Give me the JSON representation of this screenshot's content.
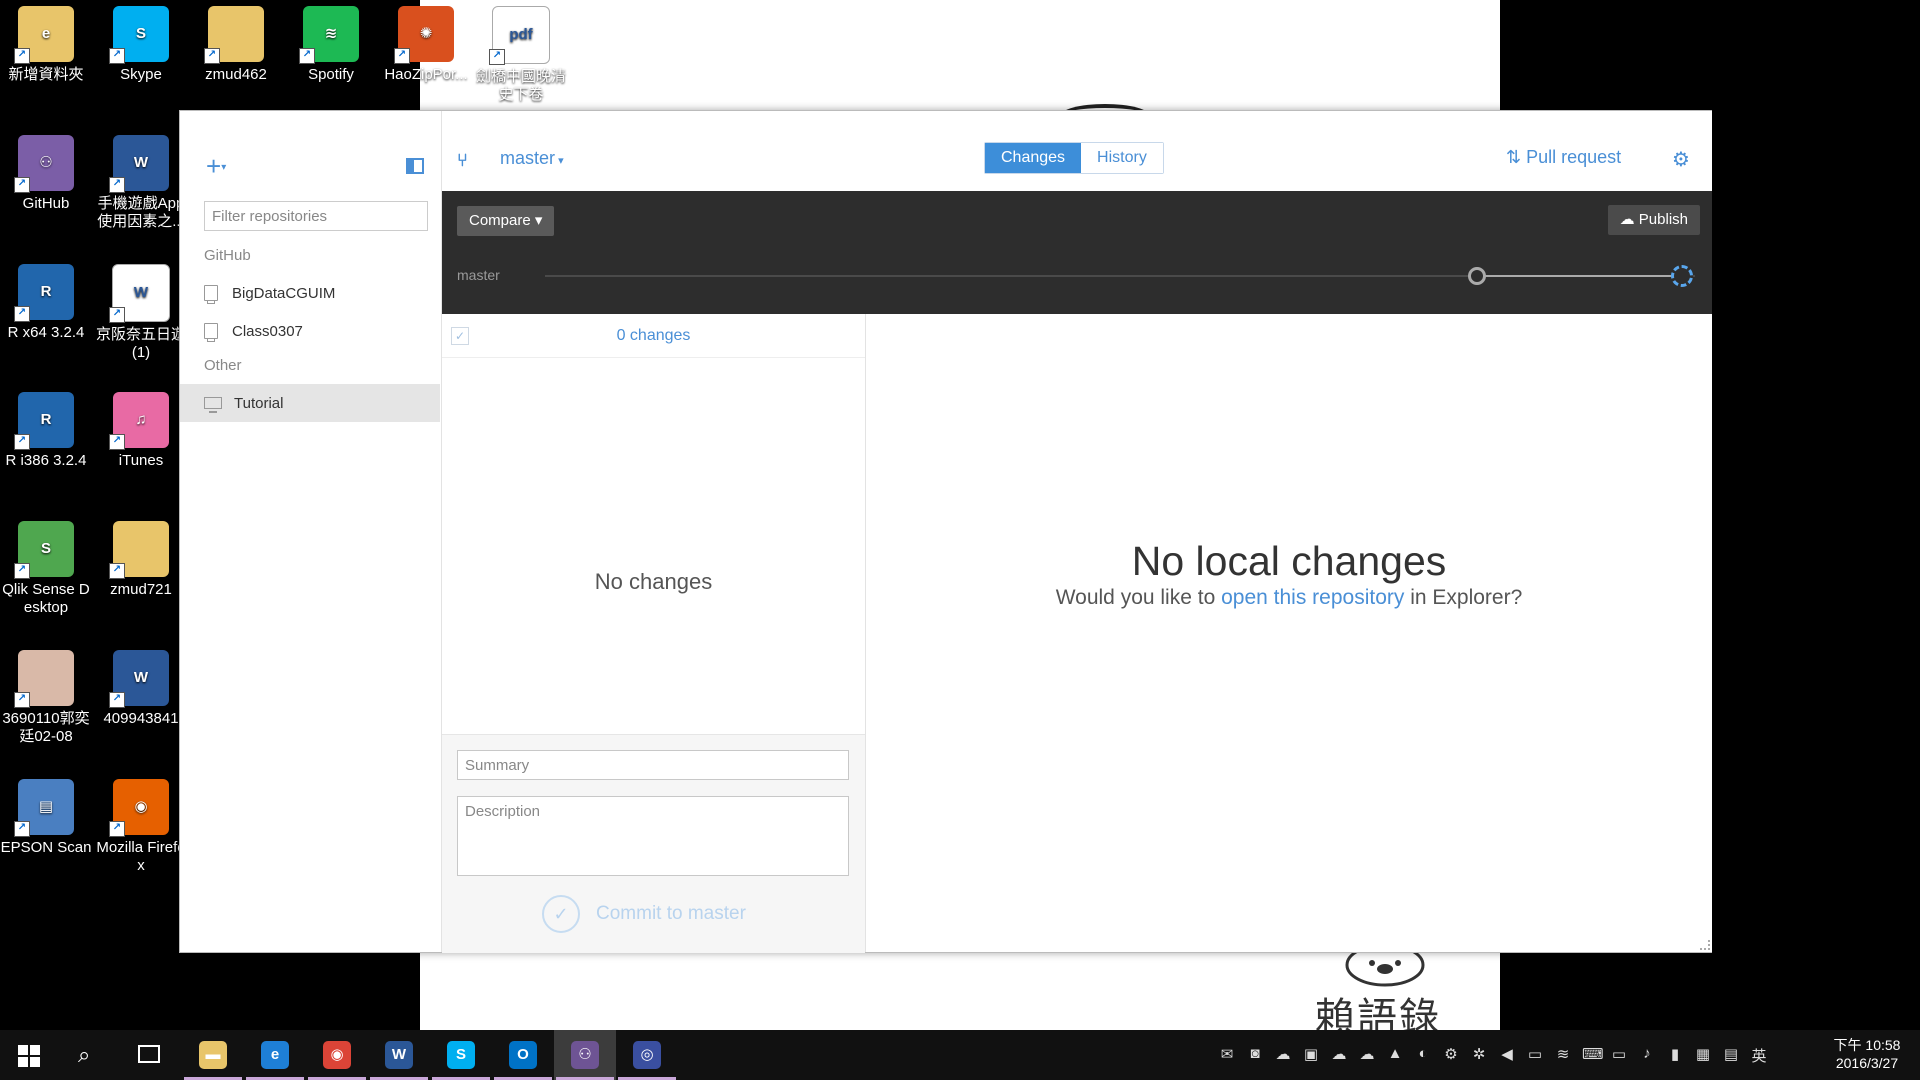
{
  "desktop": {
    "icons": [
      {
        "label": "新增資料夾",
        "color": "#e8c56a",
        "glyph": "e"
      },
      {
        "label": "Skype",
        "color": "#00aff0",
        "glyph": "S"
      },
      {
        "label": "zmud462",
        "color": "#e8c56a",
        "glyph": ""
      },
      {
        "label": "Spotify",
        "color": "#1db954",
        "glyph": "≋"
      },
      {
        "label": "HaoZipPor...",
        "color": "#d9501e",
        "glyph": "✺"
      },
      {
        "label": "劍橋中國晚清史下卷",
        "color": "#ffffff",
        "glyph": "pdf"
      },
      {
        "label": "GitHub",
        "color": "#7b5ea7",
        "glyph": "⚇"
      },
      {
        "label": "手機遊戲App使用因素之...",
        "color": "#2b5797",
        "glyph": "W"
      },
      {
        "label": "R x64 3.2.4",
        "color": "#2166ac",
        "glyph": "R"
      },
      {
        "label": "京阪奈五日遊(1)",
        "color": "#ffffff",
        "glyph": "W"
      },
      {
        "label": "R i386 3.2.4",
        "color": "#2166ac",
        "glyph": "R"
      },
      {
        "label": "iTunes",
        "color": "#e86aa4",
        "glyph": "♫"
      },
      {
        "label": "Qlik Sense Desktop",
        "color": "#4fa74f",
        "glyph": "S"
      },
      {
        "label": "zmud721",
        "color": "#e8c56a",
        "glyph": ""
      },
      {
        "label": "3690110郭奕廷02-08",
        "color": "#d9b9a8",
        "glyph": ""
      },
      {
        "label": "409943841",
        "color": "#2b5797",
        "glyph": "W"
      },
      {
        "label": "EPSON Scan",
        "color": "#4a7fc1",
        "glyph": "▤"
      },
      {
        "label": "Mozilla Firefox",
        "color": "#e66000",
        "glyph": "◉"
      }
    ],
    "wallpaper_text": "賴語錄"
  },
  "window": {
    "controls": {
      "minimize": "–",
      "maximize": "□",
      "close": "✕"
    },
    "sidebar": {
      "add_label": "+",
      "filter_placeholder": "Filter repositories",
      "group_github": "GitHub",
      "group_other": "Other",
      "repos_github": [
        "BigDataCGUIM",
        "Class0307"
      ],
      "repos_other": [
        "Tutorial"
      ],
      "selected_repo": "Tutorial"
    },
    "topbar": {
      "branch": "master",
      "tabs": [
        "Changes",
        "History"
      ],
      "active_tab": "Changes",
      "pull_request": "Pull request"
    },
    "compare_bar": {
      "compare_label": "Compare",
      "publish_label": "Publish",
      "timeline_branch": "master"
    },
    "changes": {
      "count_label": "0 changes",
      "empty_label": "No changes",
      "summary_placeholder": "Summary",
      "description_placeholder": "Description",
      "commit_label": "Commit to master"
    },
    "right_pane": {
      "title": "No local changes",
      "sub_before": "Would you like to ",
      "sub_link": "open this repository",
      "sub_after": " in Explorer?"
    }
  },
  "taskbar": {
    "apps": [
      {
        "name": "file-explorer",
        "color": "#e8c56a",
        "glyph": "▬",
        "active": false
      },
      {
        "name": "edge",
        "color": "#1e7fd6",
        "glyph": "e",
        "active": false
      },
      {
        "name": "chrome",
        "color": "#db4437",
        "glyph": "◉",
        "active": false
      },
      {
        "name": "word",
        "color": "#2b5797",
        "glyph": "W",
        "active": false
      },
      {
        "name": "skype",
        "color": "#00aff0",
        "glyph": "S",
        "active": false
      },
      {
        "name": "outlook",
        "color": "#0072c6",
        "glyph": "O",
        "active": false
      },
      {
        "name": "github",
        "color": "#6e5494",
        "glyph": "⚇",
        "active": true
      },
      {
        "name": "app-blue",
        "color": "#3a4fa0",
        "glyph": "◎",
        "active": false
      }
    ],
    "ime": "英",
    "clock_time": "下午 10:58",
    "clock_date": "2016/3/27"
  }
}
